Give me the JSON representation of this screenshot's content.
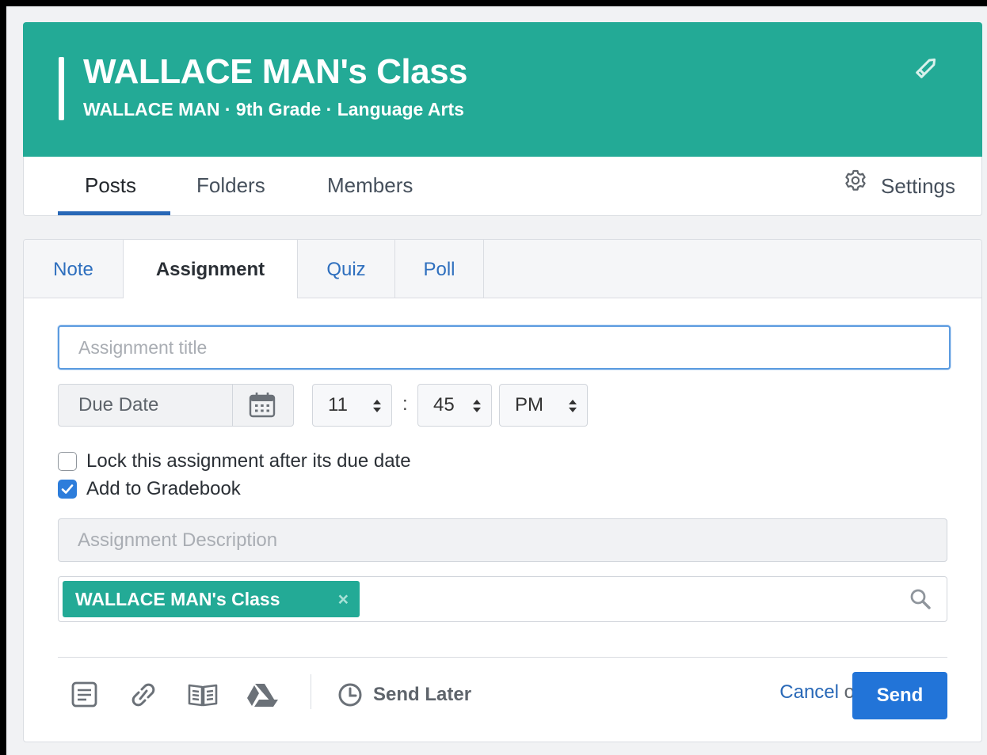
{
  "header": {
    "title": "WALLACE MAN's Class",
    "subtitle": "WALLACE MAN · 9th Grade · Language Arts",
    "edit_icon": "pencil-icon"
  },
  "nav": {
    "tabs": [
      {
        "label": "Posts",
        "active": true
      },
      {
        "label": "Folders",
        "active": false
      },
      {
        "label": "Members",
        "active": false
      }
    ],
    "settings_label": "Settings",
    "settings_icon": "gear-icon"
  },
  "composer": {
    "post_types": [
      {
        "label": "Note",
        "active": false
      },
      {
        "label": "Assignment",
        "active": true
      },
      {
        "label": "Quiz",
        "active": false
      },
      {
        "label": "Poll",
        "active": false
      }
    ],
    "title_placeholder": "Assignment title",
    "due_date_placeholder": "Due Date",
    "hour": "11",
    "minute": "45",
    "ampm": "PM",
    "time_separator": ":",
    "lock_label": "Lock this assignment after its due date",
    "lock_checked": false,
    "gradebook_label": "Add to Gradebook",
    "gradebook_checked": true,
    "description_placeholder": "Assignment Description",
    "recipient_chip": "WALLACE MAN's Class",
    "recipient_remove": "×",
    "send_later_label": "Send Later",
    "cancel_label": "Cancel",
    "or_label": " or",
    "send_label": "Send"
  },
  "colors": {
    "brand": "#23aa96",
    "link": "#2868b7",
    "primary_button": "#2274d8"
  }
}
